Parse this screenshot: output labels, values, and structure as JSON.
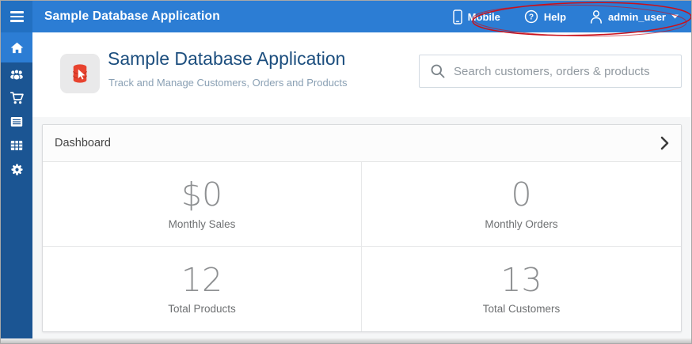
{
  "top_bar": {
    "app_title": "Sample Database Application",
    "nav": [
      {
        "label": "Mobile",
        "icon": "mobile-phone-icon"
      },
      {
        "label": "Help",
        "icon": "help-icon",
        "glyph": "?"
      },
      {
        "label": "admin_user",
        "icon": "user-icon",
        "has_caret": true
      }
    ]
  },
  "sidebar": {
    "items": [
      {
        "icon": "home-icon",
        "active": true
      },
      {
        "icon": "users-icon",
        "active": false
      },
      {
        "icon": "cart-icon",
        "active": false
      },
      {
        "icon": "list-icon",
        "active": false
      },
      {
        "icon": "grid-icon",
        "active": false
      },
      {
        "icon": "gear-icon",
        "active": false
      }
    ]
  },
  "hero": {
    "title": "Sample Database Application",
    "subtitle": "Track and Manage Customers, Orders and Products",
    "app_icon": "database-cursor-icon",
    "search": {
      "placeholder": "Search customers, orders & products",
      "value": "",
      "icon": "search-icon"
    }
  },
  "dashboard": {
    "title": "Dashboard",
    "chevron_icon": "chevron-right-icon",
    "cards": [
      {
        "value": "$0",
        "label": "Monthly Sales"
      },
      {
        "value": "0",
        "label": "Monthly Orders"
      },
      {
        "value": "12",
        "label": "Total Products"
      },
      {
        "value": "13",
        "label": "Total Customers"
      }
    ]
  },
  "annotation": {
    "type": "hand-drawn-ellipse",
    "highlights": "Mobile, Help, admin_user menu",
    "color": "#c9111b"
  },
  "colors": {
    "top_bar": "#2c7dd4",
    "menu_button": "#2270c2",
    "sidebar": "#1b5593",
    "sidebar_active": "#2c7dd4",
    "hero_title": "#1c4e7e",
    "hero_subtitle": "#8aa0b4",
    "page_background": "#f5f6f7",
    "stat_value": "#8e9092",
    "annotation": "#c9111b",
    "db_icon_red": "#e8432f"
  }
}
